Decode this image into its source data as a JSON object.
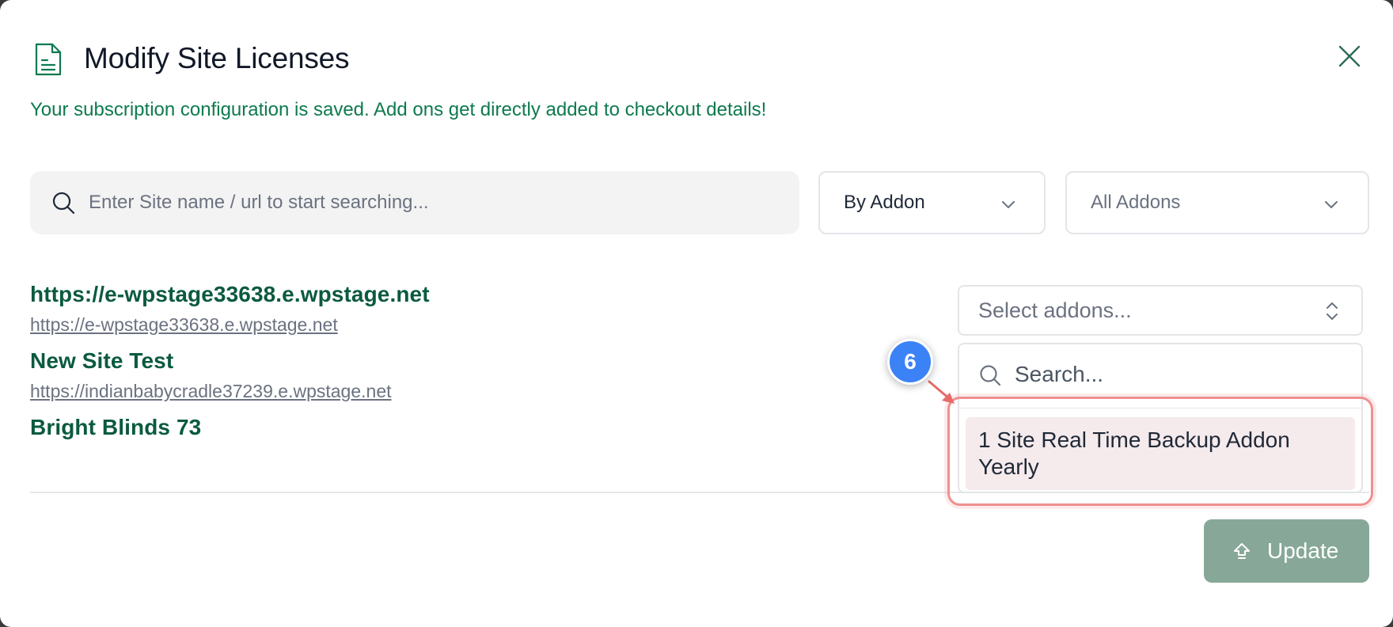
{
  "modal": {
    "title": "Modify Site Licenses",
    "notice": "Your subscription configuration is saved. Add ons get directly added to checkout details!"
  },
  "filters": {
    "search_placeholder": "Enter Site name / url to start searching...",
    "filter_by": "By Addon",
    "addon_filter": "All Addons"
  },
  "sites": [
    {
      "name": "https://e-wpstage33638.e.wpstage.net",
      "url": "https://e-wpstage33638.e.wpstage.net"
    },
    {
      "name": "New Site Test",
      "url": "https://indianbabycradle37239.e.wpstage.net"
    },
    {
      "name": "Bright Blinds 73"
    }
  ],
  "addon_picker": {
    "placeholder": "Select addons...",
    "search_placeholder": "Search...",
    "options": [
      {
        "label": "1 Site Real Time Backup Addon Yearly"
      }
    ]
  },
  "annotation": {
    "step": "6"
  },
  "footer": {
    "update_label": "Update"
  },
  "colors": {
    "accent_green": "#0d7a4e",
    "site_name_green": "#0b5a3e",
    "update_button": "#87a898",
    "highlight": "#ef8f8f",
    "step_badge": "#3b82f6",
    "option_bg": "#f5eaec"
  },
  "icons": {
    "header": "document-icon",
    "close": "close-icon",
    "search": "search-icon",
    "chevron": "chevron-down-icon",
    "updown": "chevron-updown-icon",
    "update": "upload-arrow-icon"
  }
}
